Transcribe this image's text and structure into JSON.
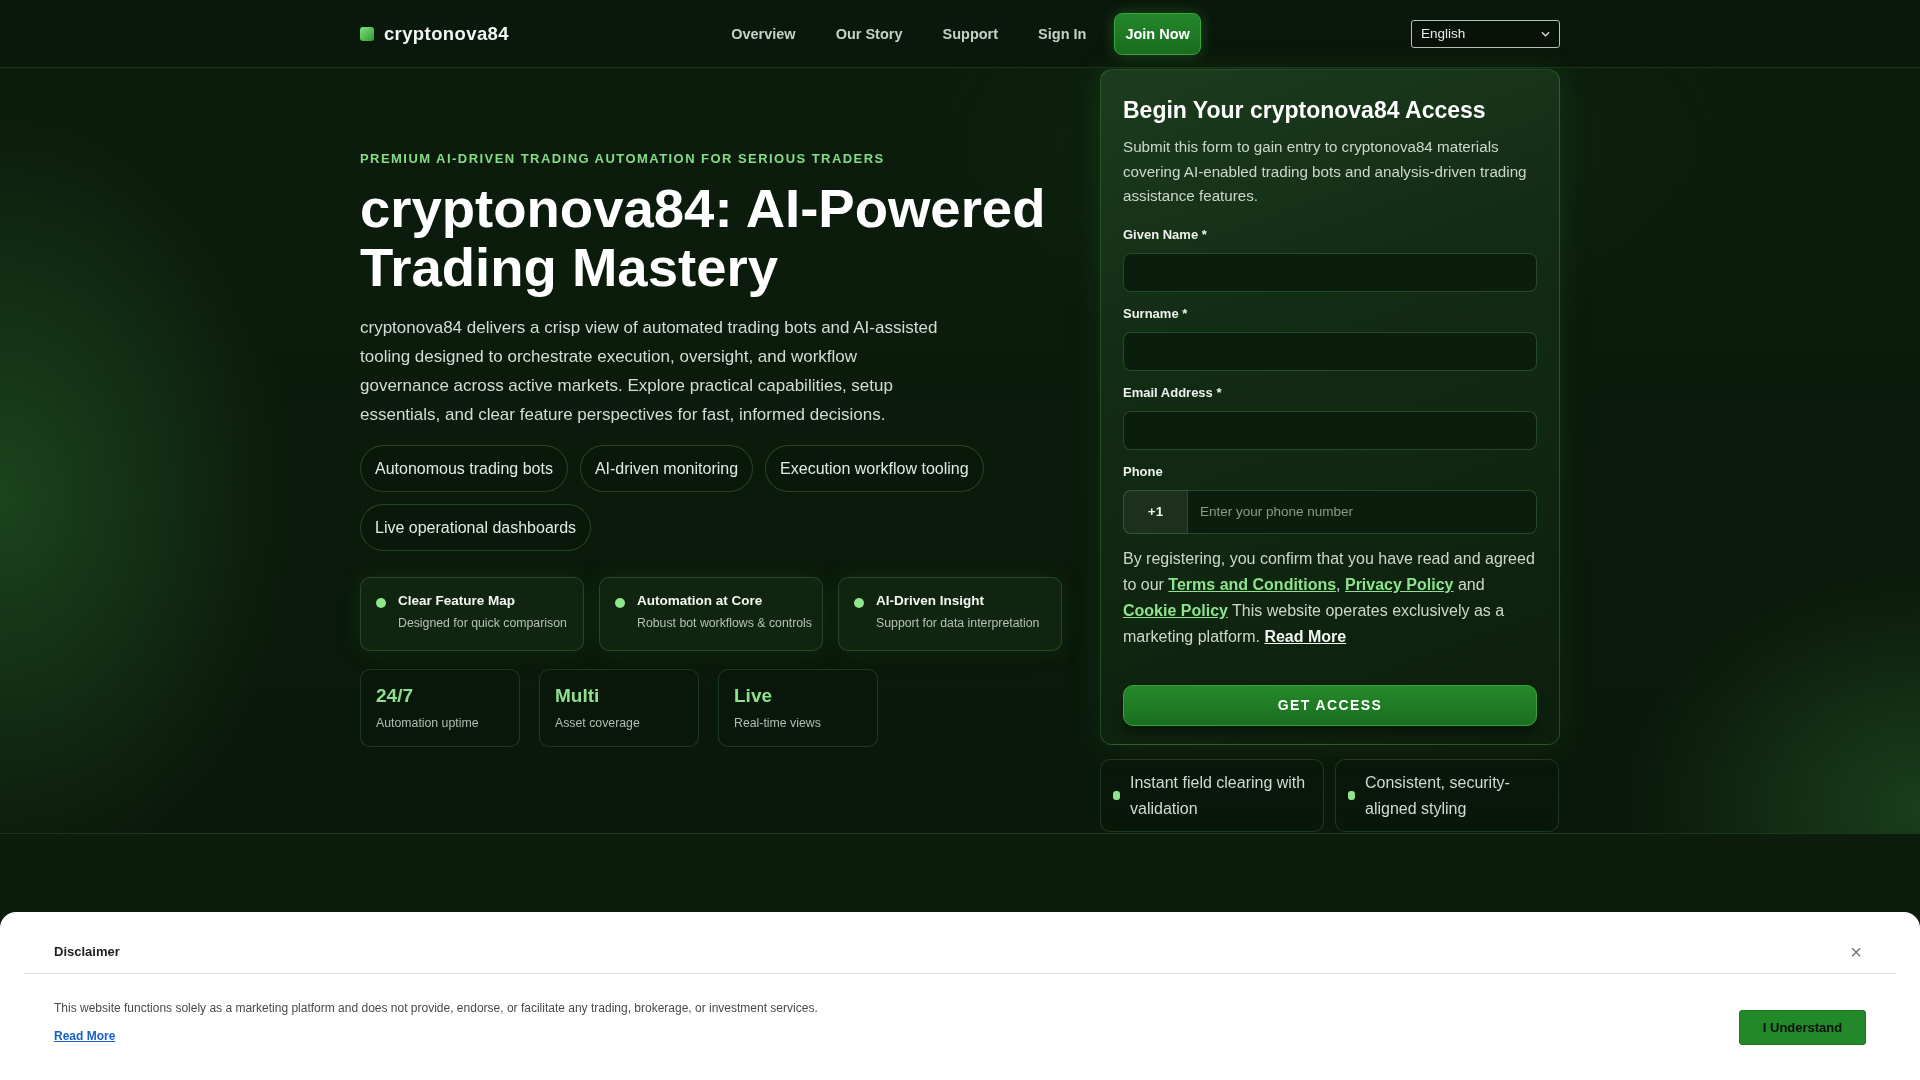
{
  "header": {
    "logo": "cryptonova84",
    "nav": [
      {
        "label": "Overview",
        "kind": "link"
      },
      {
        "label": "Our Story",
        "kind": "link"
      },
      {
        "label": "Support",
        "kind": "link"
      },
      {
        "label": "Sign In",
        "kind": "link"
      },
      {
        "label": "Join Now",
        "kind": "button"
      }
    ],
    "language": "English"
  },
  "hero": {
    "eyebrow": "PREMIUM AI-DRIVEN TRADING AUTOMATION FOR SERIOUS TRADERS",
    "title": "cryptonova84: AI-Powered Trading Mastery",
    "description": "cryptonova84 delivers a crisp view of automated trading bots and AI-assisted tooling designed to orchestrate execution, oversight, and workflow governance across active markets. Explore practical capabilities, setup essentials, and clear feature perspectives for fast, informed decisions.",
    "chips": [
      "Autonomous trading bots",
      "AI-driven monitoring",
      "Execution workflow tooling",
      "Live operational dashboards"
    ],
    "features": [
      {
        "title": "Clear Feature Map",
        "text": "Designed for quick comparison"
      },
      {
        "title": "Automation at Core",
        "text": "Robust bot workflows & controls"
      },
      {
        "title": "AI-Driven Insight",
        "text": "Support for data interpretation"
      }
    ],
    "stats": [
      {
        "value": "24/7",
        "label": "Automation uptime"
      },
      {
        "value": "Multi",
        "label": "Asset coverage"
      },
      {
        "value": "Live",
        "label": "Real-time views"
      }
    ]
  },
  "form": {
    "title": "Begin Your cryptonova84 Access",
    "description": "Submit this form to gain entry to cryptonova84 materials covering AI-enabled trading bots and analysis-driven trading assistance features.",
    "fields": [
      {
        "kind": "text",
        "label": "Given Name *"
      },
      {
        "kind": "text",
        "label": "Surname *"
      },
      {
        "kind": "text",
        "label": "Email Address *"
      },
      {
        "kind": "phone",
        "label": "Phone",
        "code": "+1",
        "placeholder": "Enter your phone number"
      }
    ],
    "consent": [
      {
        "kind": "text",
        "text": "By registering, you confirm that you have read and agreed to our "
      },
      {
        "kind": "link",
        "text": "Terms and Conditions"
      },
      {
        "kind": "text",
        "text": ", "
      },
      {
        "kind": "link",
        "text": "Privacy Policy"
      },
      {
        "kind": "text",
        "text": " and "
      },
      {
        "kind": "link",
        "text": "Cookie Policy"
      },
      {
        "kind": "text",
        "text": " This website operates exclusively as a marketing platform. "
      },
      {
        "kind": "more",
        "text": "Read More"
      }
    ],
    "submit": "GET ACCESS"
  },
  "highlights": [
    "Instant field clearing with validation",
    "Consistent, security-aligned styling"
  ],
  "disclaimer": {
    "title": "Disclaimer",
    "close": "×",
    "text": "This website functions solely as a marketing platform and does not provide, endorse, or facilitate any trading, brokerage, or investment services.",
    "link": "Read More",
    "button": "I Understand"
  }
}
